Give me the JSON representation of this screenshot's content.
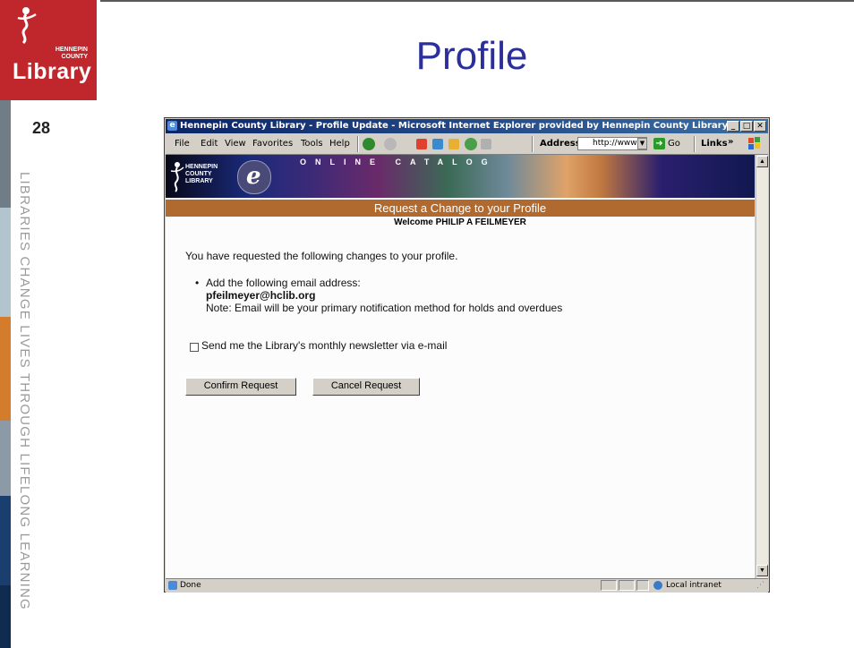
{
  "slide": {
    "title": "Profile",
    "number": "28",
    "tagline": "LIBRARIES CHANGE LIVES THROUGH LIFELONG LEARNING",
    "logo": {
      "org_line1": "HENNEPIN",
      "org_line2": "COUNTY",
      "wordmark": "Library"
    },
    "stripe_colors": [
      "#c0272d",
      "#6f7d86",
      "#a9bcc7",
      "#d27c2c",
      "#8a98a6",
      "#1a3f6e",
      "#0e2a4e"
    ]
  },
  "browser": {
    "window_title": "Hennepin County Library - Profile Update - Microsoft Internet Explorer provided by Hennepin County Library",
    "menu": [
      "File",
      "Edit",
      "View",
      "Favorites",
      "Tools",
      "Help"
    ],
    "address_label": "Address",
    "address_value": "http://www",
    "go_label": "Go",
    "links_label": "Links",
    "status_text": "Done",
    "zone_text": "Local intranet"
  },
  "page": {
    "banner_catalog": "ONLINE CATALOG",
    "banner_org": "HENNEPIN COUNTY LIBRARY",
    "heading": "Request a Change to your Profile",
    "welcome": "Welcome PHILIP A FEILMEYER",
    "intro": "You have requested the following changes to your profile.",
    "change_label": "Add the following email address:",
    "change_email": "pfeilmeyer@hclib.org",
    "change_note": "Note: Email will be your primary notification method for holds and overdues",
    "newsletter_label": "Send me the Library's monthly newsletter via e-mail",
    "newsletter_checked": false,
    "confirm_label": "Confirm Request",
    "cancel_label": "Cancel Request"
  }
}
